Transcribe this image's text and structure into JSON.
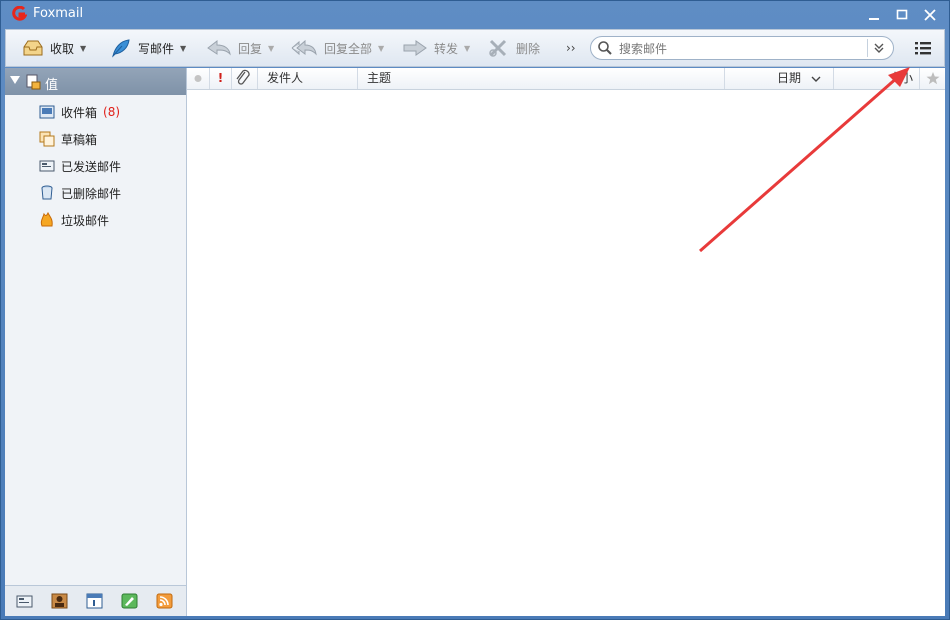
{
  "window": {
    "title": "Foxmail"
  },
  "toolbar": {
    "receive_label": "收取",
    "compose_label": "写邮件",
    "reply_label": "回复",
    "reply_all_label": "回复全部",
    "forward_label": "转发",
    "delete_label": "删除",
    "more_label": "››"
  },
  "search": {
    "placeholder": "搜索邮件"
  },
  "account": {
    "name": "值"
  },
  "folders": [
    {
      "label": "收件箱",
      "count": "(8)",
      "icon": "inbox-icon"
    },
    {
      "label": "草稿箱",
      "count": "",
      "icon": "drafts-icon"
    },
    {
      "label": "已发送邮件",
      "count": "",
      "icon": "sent-icon"
    },
    {
      "label": "已删除邮件",
      "count": "",
      "icon": "trash-icon"
    },
    {
      "label": "垃圾邮件",
      "count": "",
      "icon": "junk-icon"
    }
  ],
  "columns": {
    "flag_label": "!",
    "sender_label": "发件人",
    "subject_label": "主题",
    "date_label": "日期",
    "size_label": "大小"
  },
  "colors": {
    "accent": "#4a7bb7",
    "count": "#e0201a",
    "annotation": "#e83a3a"
  }
}
